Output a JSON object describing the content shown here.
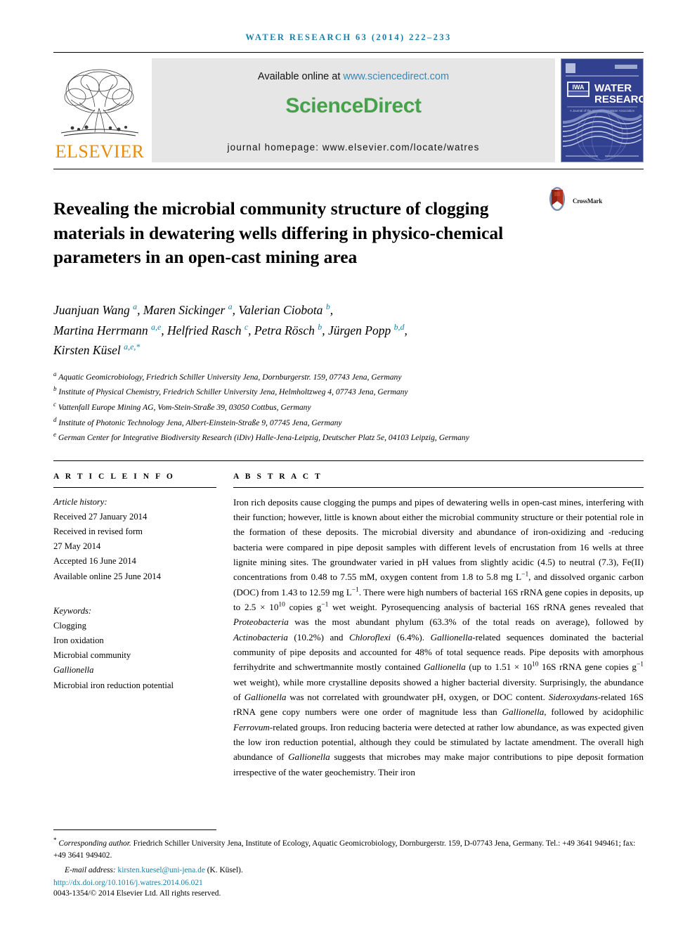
{
  "running_head": "WATER RESEARCH 63 (2014) 222–233",
  "masthead": {
    "publisher_name": "ELSEVIER",
    "publisher_logo_icon": "elsevier-tree-icon",
    "available_prefix": "Available online at ",
    "available_url": "www.sciencedirect.com",
    "sciencedirect_wordmark": "ScienceDirect",
    "homepage_line": "journal homepage: www.elsevier.com/locate/watres",
    "cover": {
      "iwa_badge": "IWA",
      "journal_name_line1": "WATER",
      "journal_name_line2": "RESEARCH",
      "tagline": "A Journal of the International Water Association"
    },
    "colors": {
      "elsevier_orange": "#ED8B00",
      "sciencedirect_green": "#46A14B",
      "link_blue": "#3a87b5",
      "panel_gray": "#e6e6e6",
      "cover_navy": "#31408f",
      "running_head_blue": "#1a7fa8"
    }
  },
  "article": {
    "title": "Revealing the microbial community structure of clogging materials in dewatering wells differing in physico-chemical parameters in an open-cast mining area",
    "crossmark_label": "CrossMark",
    "authors_html": "Juanjuan Wang <sup>a</sup>, Maren Sickinger <sup>a</sup>, Valerian Ciobota <sup>b</sup>,<br>Martina Herrmann <sup>a,e</sup>, Helfried Rasch <sup>c</sup>, Petra Rösch <sup>b</sup>, Jürgen Popp <sup>b,d</sup>,<br>Kirsten Küsel <sup>a,e,*</sup>",
    "authors": [
      {
        "name": "Juanjuan Wang",
        "marks": "a"
      },
      {
        "name": "Maren Sickinger",
        "marks": "a"
      },
      {
        "name": "Valerian Ciobota",
        "marks": "b"
      },
      {
        "name": "Martina Herrmann",
        "marks": "a,e"
      },
      {
        "name": "Helfried Rasch",
        "marks": "c"
      },
      {
        "name": "Petra Rösch",
        "marks": "b"
      },
      {
        "name": "Jürgen Popp",
        "marks": "b,d"
      },
      {
        "name": "Kirsten Küsel",
        "marks": "a,e,*"
      }
    ],
    "affiliations": [
      {
        "mark": "a",
        "text": "Aquatic Geomicrobiology, Friedrich Schiller University Jena, Dornburgerstr. 159, 07743 Jena, Germany"
      },
      {
        "mark": "b",
        "text": "Institute of Physical Chemistry, Friedrich Schiller University Jena, Helmholtzweg 4, 07743 Jena, Germany"
      },
      {
        "mark": "c",
        "text": "Vattenfall Europe Mining AG, Vom-Stein-Straße 39, 03050 Cottbus, Germany"
      },
      {
        "mark": "d",
        "text": "Institute of Photonic Technology Jena, Albert-Einstein-Straße 9, 07745 Jena, Germany"
      },
      {
        "mark": "e",
        "text": "German Center for Integrative Biodiversity Research (iDiv) Halle-Jena-Leipzig, Deutscher Platz 5e, 04103 Leipzig, Germany"
      }
    ]
  },
  "article_info": {
    "heading": "A R T I C L E   I N F O",
    "history_label": "Article history:",
    "history": [
      "Received 27 January 2014",
      "Received in revised form",
      "27 May 2014",
      "Accepted 16 June 2014",
      "Available online 25 June 2014"
    ],
    "keywords_label": "Keywords:",
    "keywords": [
      {
        "text": "Clogging",
        "italic": false
      },
      {
        "text": "Iron oxidation",
        "italic": false
      },
      {
        "text": "Microbial community",
        "italic": false
      },
      {
        "text": "Gallionella",
        "italic": true
      },
      {
        "text": "Microbial iron reduction potential",
        "italic": false
      }
    ]
  },
  "abstract": {
    "heading": "A B S T R A C T",
    "html": "Iron rich deposits cause clogging the pumps and pipes of dewatering wells in open-cast mines, interfering with their function; however, little is known about either the microbial community structure or their potential role in the formation of these deposits. The microbial diversity and abundance of iron-oxidizing and -reducing bacteria were compared in pipe deposit samples with different levels of encrustation from 16 wells at three lignite mining sites. The groundwater varied in pH values from slightly acidic (4.5) to neutral (7.3), Fe(II) concentrations from 0.48 to 7.55 mM, oxygen content from 1.8 to 5.8 mg L<sup>−1</sup>, and dissolved organic carbon (DOC) from 1.43 to 12.59 mg L<sup>−1</sup>. There were high numbers of bacterial 16S rRNA gene copies in deposits, up to 2.5 × 10<sup>10</sup> copies g<sup>−1</sup> wet weight. Pyrosequencing analysis of bacterial 16S rRNA genes revealed that <i>Proteobacteria</i> was the most abundant phylum (63.3% of the total reads on average), followed by <i>Actinobacteria</i> (10.2%) and <i>Chloroflexi</i> (6.4%). <i>Gallionella</i>-related sequences dominated the bacterial community of pipe deposits and accounted for 48% of total sequence reads. Pipe deposits with amorphous ferrihydrite and schwertmannite mostly contained <i>Gallionella</i> (up to 1.51 × 10<sup>10</sup> 16S rRNA gene copies g<sup>−1</sup> wet weight), while more crystalline deposits showed a higher bacterial diversity. Surprisingly, the abundance of <i>Gallionella</i> was not correlated with groundwater pH, oxygen, or DOC content. <i>Sideroxydans</i>-related 16S rRNA gene copy numbers were one order of magnitude less than <i>Gallionella</i>, followed by acidophilic <i>Ferrovum</i>-related groups. Iron reducing bacteria were detected at rather low abundance, as was expected given the low iron reduction potential, although they could be stimulated by lactate amendment. The overall high abundance of <i>Gallionella</i> suggests that microbes may make major contributions to pipe deposit formation irrespective of the water geochemistry. Their iron"
  },
  "footer": {
    "corresponding_prefix": "Corresponding author.",
    "corresponding_text": " Friedrich Schiller University Jena, Institute of Ecology, Aquatic Geomicrobiology, Dornburgerstr. 159, D-07743 Jena, Germany. Tel.: +49 3641 949461; fax: +49 3641 949402.",
    "email_label": "E-mail address:",
    "email": "kirsten.kuesel@uni-jena.de",
    "email_suffix": " (K. Küsel).",
    "doi": "http://dx.doi.org/10.1016/j.watres.2014.06.021",
    "copyright": "0043-1354/© 2014 Elsevier Ltd. All rights reserved."
  }
}
